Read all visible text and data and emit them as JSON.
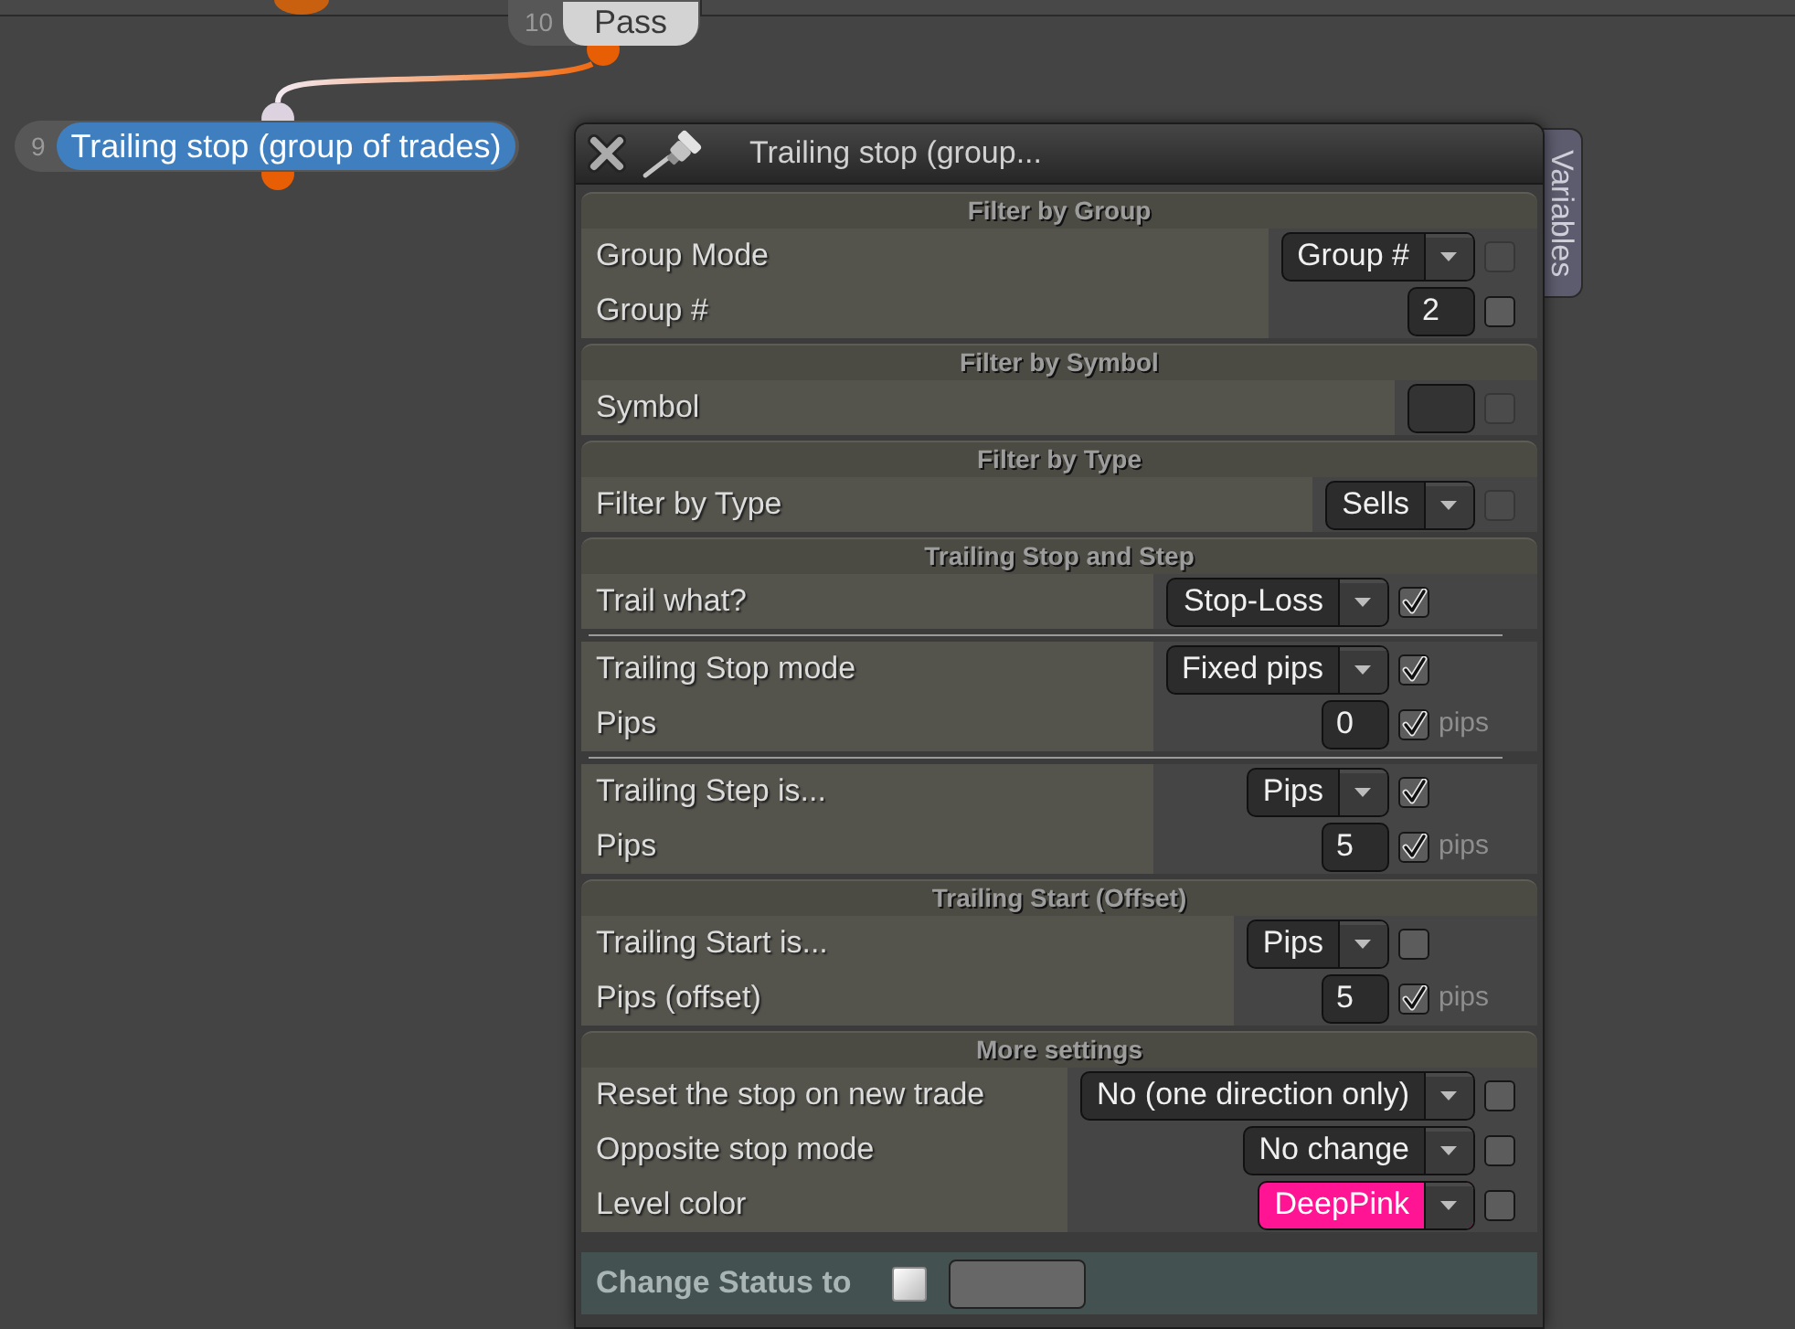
{
  "nodes": [
    {
      "number": "10",
      "label": "Pass",
      "selected": false
    },
    {
      "number": "9",
      "label": "Trailing stop (group of trades)",
      "selected": true
    }
  ],
  "dialog": {
    "title": "Trailing stop (group...",
    "side_tab": "Variables",
    "sections": [
      {
        "title": "Filter by Group",
        "groups": [
          {
            "rows": [
              {
                "label": "Group Mode",
                "kind": "dropdown",
                "value": "Group #",
                "check": {
                  "checked": false,
                  "disabled": true
                }
              },
              {
                "label": "Group #",
                "kind": "number",
                "value": "2",
                "check": {
                  "checked": false,
                  "disabled": false
                }
              }
            ]
          }
        ]
      },
      {
        "title": "Filter by Symbol",
        "groups": [
          {
            "rows": [
              {
                "label": "Symbol",
                "kind": "text",
                "check": {
                  "checked": false,
                  "disabled": true
                }
              }
            ]
          }
        ]
      },
      {
        "title": "Filter by Type",
        "groups": [
          {
            "rows": [
              {
                "label": "Filter by Type",
                "kind": "dropdown",
                "value": "Sells",
                "check": {
                  "checked": false,
                  "disabled": true
                }
              }
            ]
          }
        ]
      },
      {
        "title": "Trailing Stop and Step",
        "groups": [
          {
            "rows": [
              {
                "label": "Trail what?",
                "kind": "dropdown",
                "value": "Stop-Loss",
                "check": {
                  "checked": true,
                  "disabled": false
                }
              }
            ]
          },
          {
            "rows": [
              {
                "label": "Trailing Stop mode",
                "kind": "dropdown",
                "value": "Fixed pips",
                "check": {
                  "checked": true,
                  "disabled": false
                }
              },
              {
                "label": "Pips",
                "kind": "number",
                "value": "0",
                "check": {
                  "checked": true,
                  "disabled": false
                },
                "unit": "pips"
              }
            ]
          },
          {
            "rows": [
              {
                "label": "Trailing Step is...",
                "kind": "dropdown",
                "value": "Pips",
                "check": {
                  "checked": true,
                  "disabled": false
                }
              },
              {
                "label": "Pips",
                "kind": "number",
                "value": "5",
                "check": {
                  "checked": true,
                  "disabled": false
                },
                "unit": "pips"
              }
            ]
          }
        ]
      },
      {
        "title": "Trailing Start (Offset)",
        "groups": [
          {
            "rows": [
              {
                "label": "Trailing Start is...",
                "kind": "dropdown",
                "value": "Pips",
                "check": {
                  "checked": false,
                  "disabled": false
                }
              },
              {
                "label": "Pips (offset)",
                "kind": "number",
                "value": "5",
                "check": {
                  "checked": true,
                  "disabled": false
                },
                "unit": "pips"
              }
            ]
          }
        ]
      },
      {
        "title": "More settings",
        "groups": [
          {
            "rows": [
              {
                "label": "Reset the stop on new trade",
                "kind": "dropdown",
                "value": "No (one direction only)",
                "check": {
                  "checked": false,
                  "disabled": false
                }
              },
              {
                "label": "Opposite stop mode",
                "kind": "dropdown",
                "value": "No change",
                "check": {
                  "checked": false,
                  "disabled": false
                }
              },
              {
                "label": "Level color",
                "kind": "dropdown",
                "value": "DeepPink",
                "color": "#ff1493",
                "check": {
                  "checked": false,
                  "disabled": false
                }
              }
            ]
          }
        ]
      }
    ],
    "status_row": {
      "label": "Change Status to",
      "checked": false
    }
  }
}
